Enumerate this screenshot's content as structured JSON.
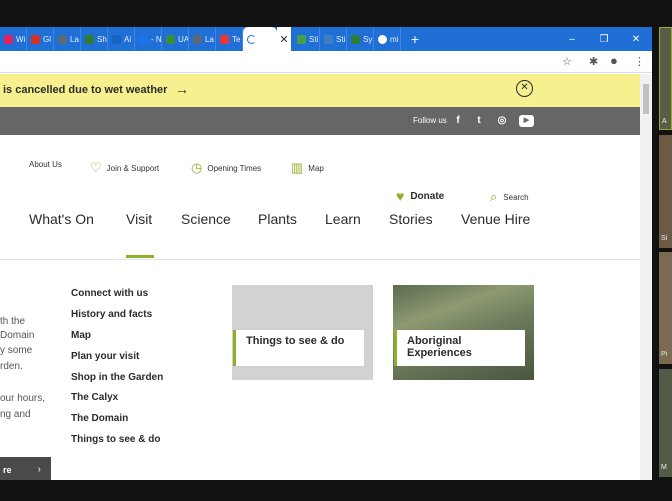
{
  "tabs": [
    {
      "label": "Wi",
      "color": "#e0245e"
    },
    {
      "label": "Gl",
      "color": "#d93025"
    },
    {
      "label": "La",
      "color": "#5a6a7a"
    },
    {
      "label": "Sh",
      "color": "#2e7d32"
    },
    {
      "label": "Ai",
      "color": "#1565c0"
    },
    {
      "label": "- N",
      "color": "#1a73e8"
    },
    {
      "label": "UA",
      "color": "#388e3c"
    },
    {
      "label": "La",
      "color": "#5a6a7a"
    },
    {
      "label": "Te",
      "color": "#e53935"
    },
    {
      "label": "",
      "color": "#1a73e8"
    },
    {
      "label": "Sti",
      "color": "#43a047"
    },
    {
      "label": "Sti",
      "color": "#3f7fbf"
    },
    {
      "label": "Sy",
      "color": "#2e7d32"
    },
    {
      "label": "mi",
      "color": "#ffffff"
    }
  ],
  "window": {
    "new_tab": "+",
    "minimize": "–",
    "restore": "❐",
    "close": "✕",
    "tab_close": "✕"
  },
  "toolbar": {
    "star": "☆",
    "extensions": "✱",
    "profile": "●",
    "menu": "⋮"
  },
  "banner": {
    "text": "is cancelled due to wet weather",
    "arrow": "→",
    "close": "✕"
  },
  "social": {
    "label": "Follow us",
    "icons": [
      "f",
      "t",
      "◎",
      "▶"
    ]
  },
  "utility": {
    "about": "About Us",
    "join": "Join & Support",
    "opening": "Opening Times",
    "map": "Map",
    "donate": "Donate",
    "search": "Search"
  },
  "mainnav": [
    "What's On",
    "Visit",
    "Science",
    "Plants",
    "Learn",
    "Stories",
    "Venue Hire"
  ],
  "cut_text": [
    "th the",
    "Domain",
    "y some",
    "rden.",
    "our hours,",
    "ng and"
  ],
  "dropdown": [
    "Connect with us",
    "History and facts",
    "Map",
    "Plan your visit",
    "Shop in the Garden",
    "The Calyx",
    "The Domain",
    "Things to see & do"
  ],
  "cards": [
    {
      "label": "Things to see & do"
    },
    {
      "label": "Aboriginal Experiences"
    }
  ],
  "more_button": {
    "label": "re",
    "arrow": "›"
  },
  "side_videos": [
    "A",
    "Si",
    "Pi",
    "M"
  ],
  "colors": {
    "accent": "#8cb027",
    "banner": "#f6f08f",
    "tabbar": "#1f6fd6"
  }
}
